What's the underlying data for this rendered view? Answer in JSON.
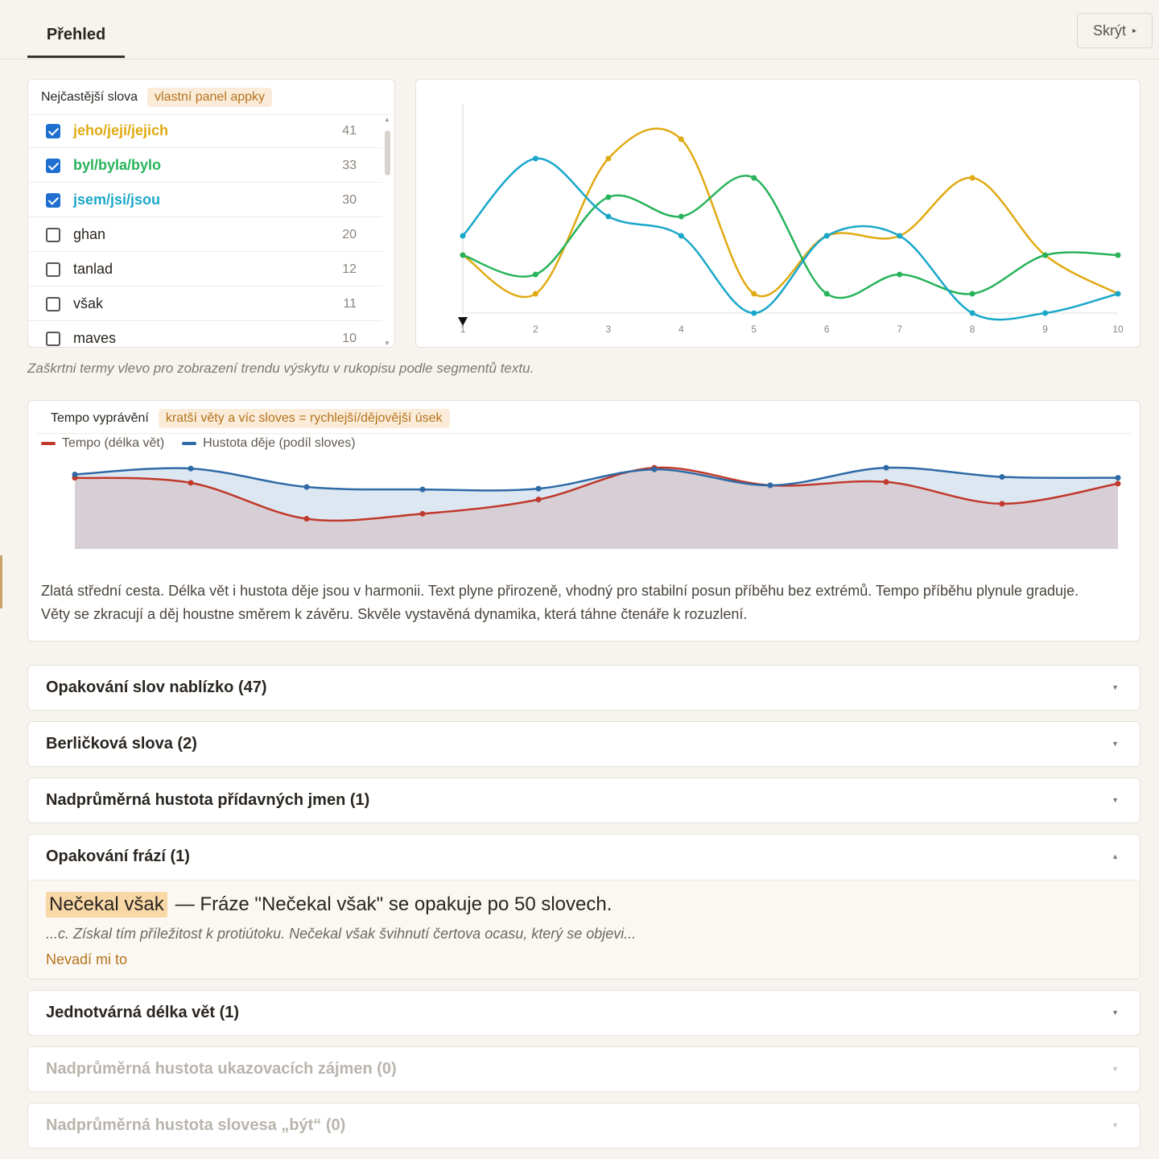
{
  "header": {
    "tab_overview": "Přehled",
    "hide_button": "Skrýt"
  },
  "words_panel": {
    "title": "Nejčastější slova",
    "badge": "vlastní panel appky",
    "items": [
      {
        "label": "jeho/její/jejich",
        "count": "41",
        "checked": true,
        "color": "#e0aa12"
      },
      {
        "label": "byl/byla/bylo",
        "count": "33",
        "checked": true,
        "color": "#27b35a"
      },
      {
        "label": "jsem/jsi/jsou",
        "count": "30",
        "checked": true,
        "color": "#19a7c9"
      },
      {
        "label": "ghan",
        "count": "20",
        "checked": false,
        "color": "#2a2520"
      },
      {
        "label": "tanlad",
        "count": "12",
        "checked": false,
        "color": "#2a2520"
      },
      {
        "label": "však",
        "count": "11",
        "checked": false,
        "color": "#2a2520"
      },
      {
        "label": "maves",
        "count": "10",
        "checked": false,
        "color": "#2a2520"
      }
    ]
  },
  "trend_hint": "Zaškrtni termy vlevo pro zobrazení trendu výskytu v rukopisu podle segmentů textu.",
  "chart_data": [
    {
      "type": "line",
      "x": [
        1,
        2,
        3,
        4,
        5,
        6,
        7,
        8,
        9,
        10
      ],
      "xticks": [
        "1",
        "2",
        "3",
        "4",
        "5",
        "6",
        "7",
        "8",
        "9",
        "10"
      ],
      "ylim": [
        0,
        10
      ],
      "smooth": true,
      "grid": false,
      "series": [
        {
          "name": "jeho/její/jejich",
          "color": "#e0aa12",
          "values": [
            3,
            1,
            8,
            9,
            1,
            4,
            4,
            7,
            3,
            1
          ]
        },
        {
          "name": "byl/byla/bylo",
          "color": "#27b35a",
          "values": [
            3,
            2,
            6,
            5,
            7,
            1,
            2,
            1,
            3,
            3
          ]
        },
        {
          "name": "jsem/jsi/jsou",
          "color": "#19a7c9",
          "values": [
            4,
            8,
            5,
            4,
            0,
            4,
            4,
            0,
            0,
            1
          ]
        }
      ]
    },
    {
      "type": "area",
      "x": [
        1,
        2,
        3,
        4,
        5,
        6,
        7,
        8,
        9,
        10
      ],
      "ylim": [
        0,
        100
      ],
      "smooth": true,
      "legend": "top-left",
      "series": [
        {
          "name": "Tempo (délka vět)",
          "color": "#c0392b",
          "values": [
            85,
            79,
            36,
            42,
            59,
            97,
            76,
            80,
            54,
            78
          ]
        },
        {
          "name": "Hustota děje (podíl sloves)",
          "color": "#2e6aa6",
          "values": [
            89,
            96,
            74,
            71,
            72,
            95,
            76,
            97,
            86,
            85
          ]
        }
      ]
    }
  ],
  "tempo_panel": {
    "title": "Tempo vyprávění",
    "badge": "kratší věty a víc sloves = rychlejší/dějovější úsek",
    "legend_tempo": "Tempo (délka vět)",
    "legend_density": "Hustota děje (podíl sloves)",
    "summary": "Zlatá střední cesta. Délka vět i hustota děje jsou v harmonii. Text plyne přirozeně, vhodný pro stabilní posun příběhu bez extrémů. Tempo příběhu plynule graduje. Věty se zkracují a děj houstne směrem k závěru. Skvěle vystavěná dynamika, která táhne čtenáře k rozuzlení."
  },
  "sections": {
    "repetition_nearby": "Opakování slov nablízko (47)",
    "crutch_words": "Berličková slova (2)",
    "adjective_density": "Nadprůměrná hustota přídavných jmen (1)",
    "phrase_repetition": "Opakování frází (1)",
    "monotone_sentences": "Jednotvárná délka vět (1)",
    "demonstrative_density": "Nadprůměrná hustota ukazovacích zájmen (0)",
    "byt_density": "Nadprůměrná hustota slovesa „být“ (0)"
  },
  "phrase_issue": {
    "phrase": "Nečekal však",
    "description": "— Fráze \"Nečekal však\" se opakuje po 50 slovech.",
    "context": "...c. Získal tím příležitost k protiútoku. Nečekal však švihnutí čertova ocasu, který se objevi...",
    "ignore_link": "Nevadí mi to"
  }
}
